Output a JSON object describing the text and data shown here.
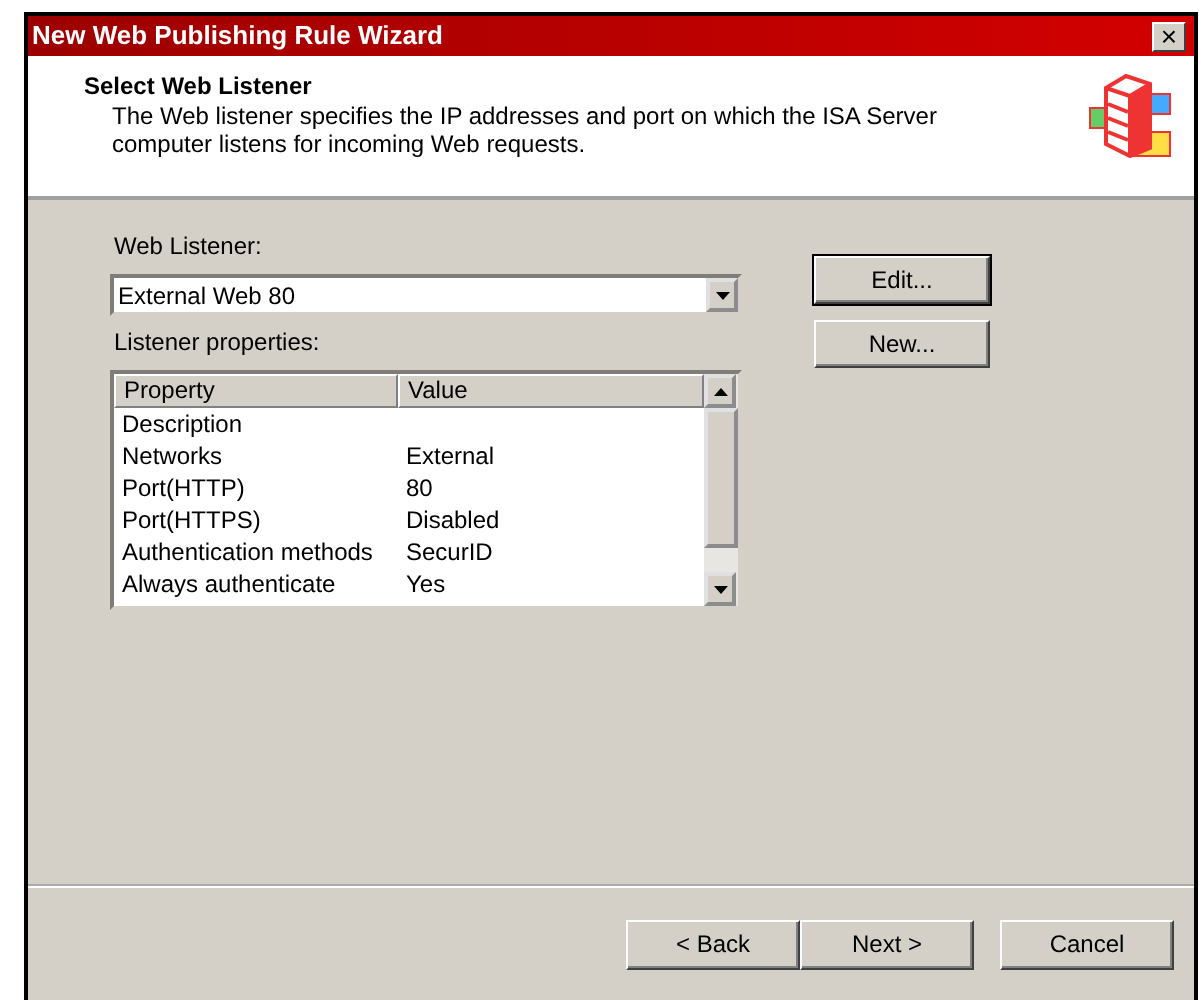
{
  "window": {
    "title": "New Web Publishing Rule Wizard",
    "close": "×"
  },
  "header": {
    "title": "Select Web Listener",
    "description": "The Web listener specifies the IP addresses and port on which the ISA Server computer listens for incoming Web requests."
  },
  "listener": {
    "label": "Web Listener:",
    "value": "External Web 80"
  },
  "side_buttons": [
    {
      "label": "Edit...",
      "default": true
    },
    {
      "label": "New...",
      "default": false
    }
  ],
  "properties": {
    "label": "Listener properties:",
    "columns": [
      "Property",
      "Value"
    ],
    "rows": [
      [
        "Description",
        ""
      ],
      [
        "Networks",
        "External"
      ],
      [
        "Port(HTTP)",
        "80"
      ],
      [
        "Port(HTTPS)",
        "Disabled"
      ],
      [
        "Authentication methods",
        "SecurID"
      ],
      [
        "Always authenticate",
        "Yes"
      ]
    ]
  },
  "buttons": [
    "< Back",
    "Next >",
    "Cancel"
  ]
}
